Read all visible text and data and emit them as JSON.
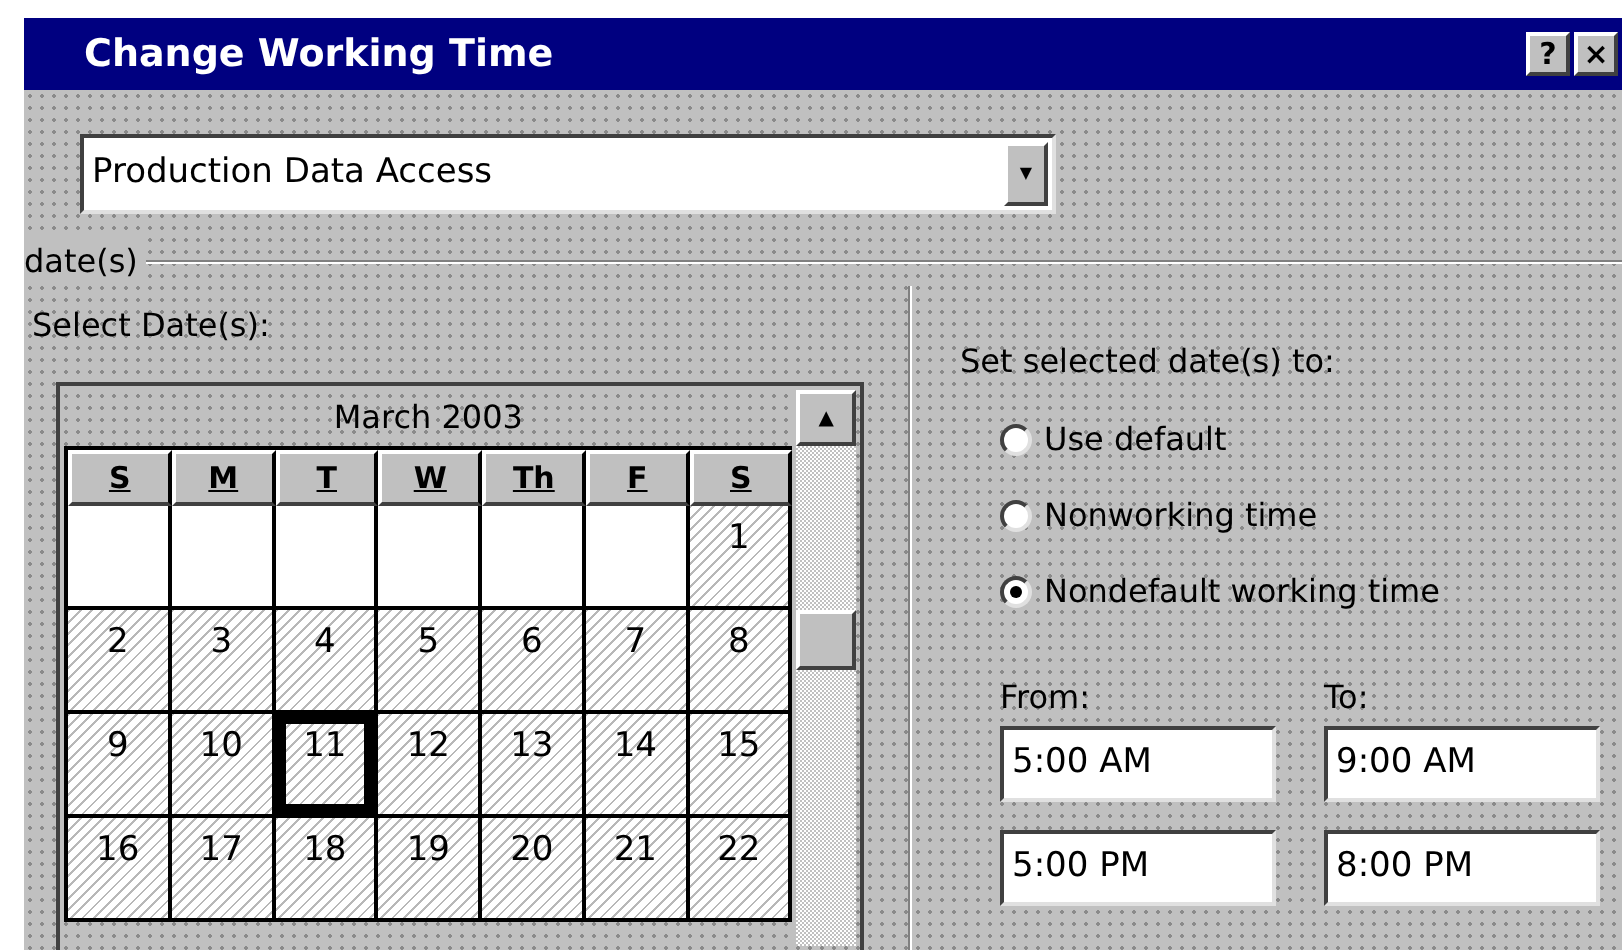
{
  "window": {
    "title": "Change Working Time",
    "buttons": [
      "?",
      "×"
    ]
  },
  "calendar_for": {
    "value": "Production Data Access",
    "arrow": "▼"
  },
  "group_label": "date(s)",
  "select_dates": {
    "label": "Select Date(s):",
    "month": "March 2003",
    "scroll_up": "▲",
    "weekdays": [
      "S",
      "M",
      "T",
      "W",
      "Th",
      "F",
      "S"
    ],
    "weeks": [
      [
        {
          "hatched": false,
          "selected": false
        },
        {
          "hatched": false,
          "selected": false
        },
        {
          "hatched": false,
          "selected": false
        },
        {
          "hatched": false,
          "selected": false
        },
        {
          "hatched": false,
          "selected": false
        },
        {
          "hatched": false,
          "selected": false
        },
        {
          "day": "1",
          "hatched": true,
          "selected": false
        }
      ],
      [
        {
          "day": "2",
          "hatched": true,
          "selected": false
        },
        {
          "day": "3",
          "hatched": true,
          "selected": false
        },
        {
          "day": "4",
          "hatched": true,
          "selected": false
        },
        {
          "day": "5",
          "hatched": true,
          "selected": false
        },
        {
          "day": "6",
          "hatched": true,
          "selected": false
        },
        {
          "day": "7",
          "hatched": true,
          "selected": false
        },
        {
          "day": "8",
          "hatched": true,
          "selected": false
        }
      ],
      [
        {
          "day": "9",
          "hatched": true,
          "selected": false
        },
        {
          "day": "10",
          "hatched": true,
          "selected": false
        },
        {
          "day": "11",
          "hatched": true,
          "selected": true
        },
        {
          "day": "12",
          "hatched": true,
          "selected": false
        },
        {
          "day": "13",
          "hatched": true,
          "selected": false
        },
        {
          "day": "14",
          "hatched": true,
          "selected": false
        },
        {
          "day": "15",
          "hatched": true,
          "selected": false
        }
      ],
      [
        {
          "day": "16",
          "hatched": true,
          "selected": false
        },
        {
          "day": "17",
          "hatched": true,
          "selected": false
        },
        {
          "day": "18",
          "hatched": true,
          "selected": false
        },
        {
          "day": "19",
          "hatched": true,
          "selected": false
        },
        {
          "day": "20",
          "hatched": true,
          "selected": false
        },
        {
          "day": "21",
          "hatched": true,
          "selected": false
        },
        {
          "day": "22",
          "hatched": true,
          "selected": false
        }
      ]
    ]
  },
  "set_to": {
    "label": "Set selected date(s) to:",
    "options": [
      {
        "label": "Use default",
        "selected": false
      },
      {
        "label": "Nonworking time",
        "selected": false
      },
      {
        "label": "Nondefault working time",
        "selected": true
      }
    ],
    "from_label": "From:",
    "to_label": "To:",
    "shifts": [
      {
        "from": "5:00 AM",
        "to": "9:00 AM"
      },
      {
        "from": "5:00 PM",
        "to": "8:00 PM"
      }
    ]
  }
}
